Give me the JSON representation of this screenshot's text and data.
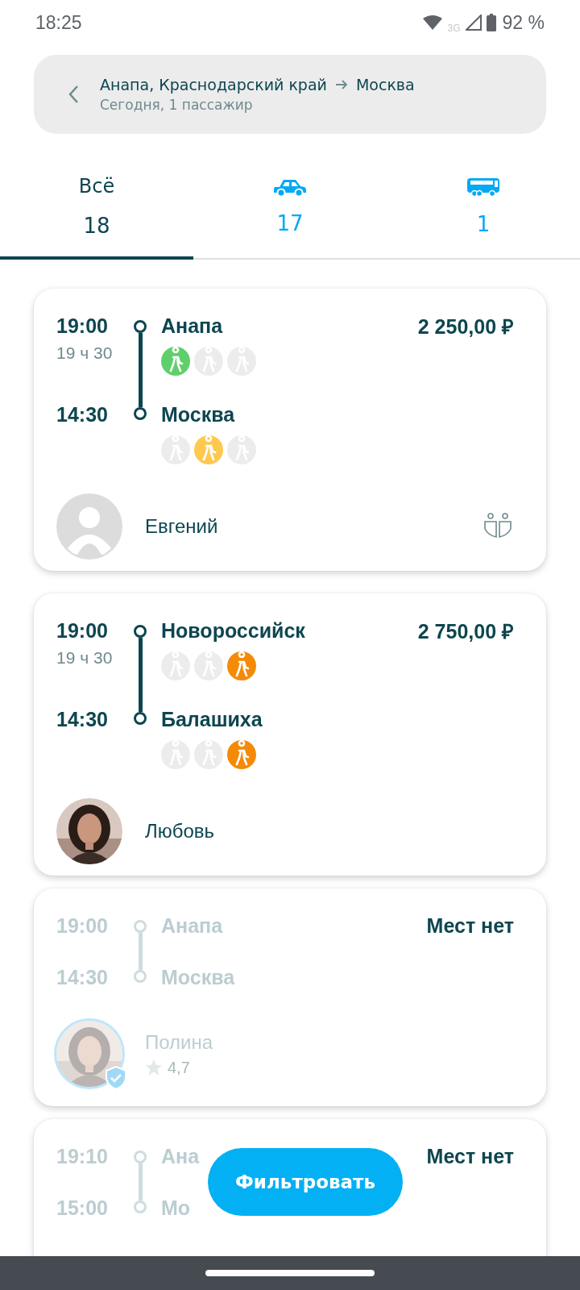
{
  "status_bar": {
    "time": "18:25",
    "network": "3G",
    "battery": "92 %"
  },
  "header": {
    "from": "Анапа, Краснодарский край",
    "to": "Москва",
    "subtitle": "Сегодня, 1 пассажир"
  },
  "tabs": [
    {
      "kind": "text",
      "label": "Всё",
      "count": "18",
      "selected": true
    },
    {
      "kind": "car",
      "count": "17",
      "selected": false
    },
    {
      "kind": "bus",
      "count": "1",
      "selected": false
    }
  ],
  "trips": [
    {
      "available": true,
      "depart": "19:00",
      "duration": "19 ч 30",
      "arrive": "14:30",
      "from": "Анапа",
      "to": "Москва",
      "price": "2 250,00 ₽",
      "from_seats": [
        {
          "selected": true,
          "color": "#5fcf6b"
        },
        {
          "selected": false
        },
        {
          "selected": false
        }
      ],
      "to_seats": [
        {
          "selected": false
        },
        {
          "selected": true,
          "color": "#ffc84f"
        },
        {
          "selected": false
        }
      ],
      "driver": {
        "name": "Евгений",
        "kind": "placeholder"
      },
      "companions": true
    },
    {
      "available": true,
      "depart": "19:00",
      "duration": "19 ч 30",
      "arrive": "14:30",
      "from": "Новороссийск",
      "to": "Балашиха",
      "price": "2 750,00 ₽",
      "from_seats": [
        {
          "selected": false
        },
        {
          "selected": false
        },
        {
          "selected": true,
          "color": "#f58a07"
        }
      ],
      "to_seats": [
        {
          "selected": false
        },
        {
          "selected": false
        },
        {
          "selected": true,
          "color": "#f58a07"
        }
      ],
      "driver": {
        "name": "Любовь",
        "kind": "picture"
      }
    },
    {
      "available": false,
      "depart": "19:00",
      "arrive": "14:30",
      "from": "Анапа",
      "to": "Москва",
      "price": "Мест нет",
      "driver": {
        "name": "Полина",
        "rating": "4,7",
        "kind": "picture",
        "verified": true
      }
    },
    {
      "available": false,
      "depart": "19:10",
      "arrive": "15:00",
      "from": "Ана",
      "to": "Мо",
      "price": "Мест нет"
    }
  ],
  "filter_button": "Фильтровать"
}
